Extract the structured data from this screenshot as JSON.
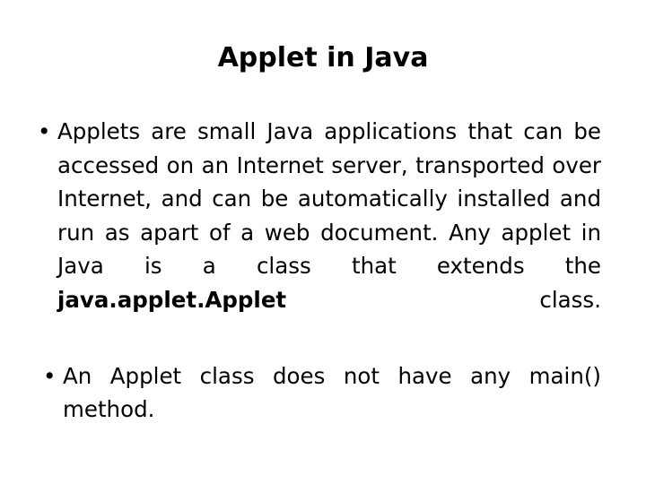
{
  "slide": {
    "title": "Applet in Java",
    "bullets": [
      {
        "marker": "•",
        "text_before_bold": "Applets are small Java applications that can be accessed on an Internet server, transported over Internet, and can be automatically installed and run as apart of a web document. Any applet in Java is a class that extends the ",
        "bold_text": "java.applet.Applet",
        "text_after_bold": " class."
      },
      {
        "marker": "•",
        "text_before_bold": "An Applet class does not have any main() method.",
        "bold_text": "",
        "text_after_bold": ""
      }
    ]
  }
}
